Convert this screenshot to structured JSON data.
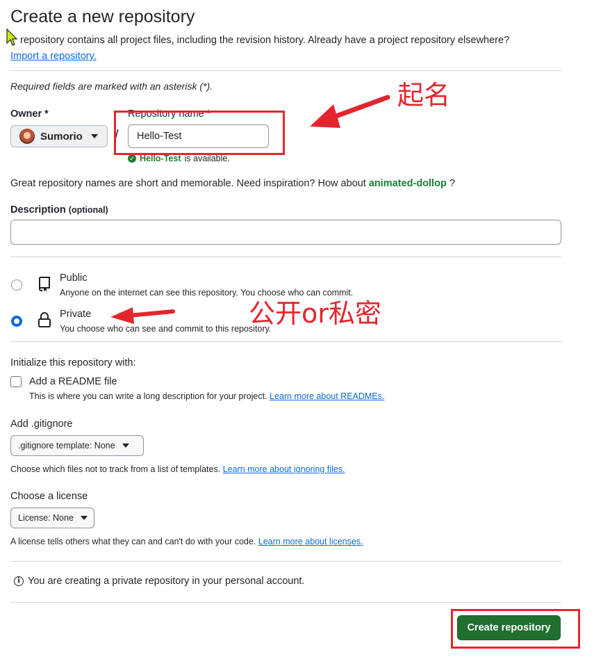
{
  "page": {
    "title": "Create a new repository",
    "intro": "repository contains all project files, including the revision history. Already have a project repository elsewhere?",
    "import_link": "Import a repository.",
    "required_note": "Required fields are marked with an asterisk (*)."
  },
  "owner": {
    "label": "Owner *",
    "value": "Sumorio"
  },
  "repo_name": {
    "label": "Repository name *",
    "value": "Hello-Test",
    "available_name": "Hello-Test",
    "available_text": "is available."
  },
  "suggestion": {
    "prefix": "Great repository names are short and memorable. Need inspiration? How about",
    "name": "animated-dollop",
    "suffix": "?"
  },
  "description": {
    "label": "Description",
    "optional": "(optional)",
    "value": ""
  },
  "visibility": {
    "selected": "private",
    "public": {
      "title": "Public",
      "desc": "Anyone on the internet can see this repository. You choose who can commit."
    },
    "private": {
      "title": "Private",
      "desc": "You choose who can see and commit to this repository."
    }
  },
  "init": {
    "heading": "Initialize this repository with:",
    "readme_label": "Add a README file",
    "readme_checked": false,
    "readme_desc": "This is where you can write a long description for your project.",
    "readme_link": "Learn more about READMEs."
  },
  "gitignore": {
    "heading": "Add .gitignore",
    "button": ".gitignore template: None",
    "desc": "Choose which files not to track from a list of templates.",
    "link": "Learn more about ignoring files."
  },
  "license": {
    "heading": "Choose a license",
    "button": "License: None",
    "desc": "A license tells others what they can and can't do with your code.",
    "link": "Learn more about licenses."
  },
  "notice": "You are creating a private repository in your personal account.",
  "create_button": "Create repository",
  "annotations": {
    "name_note": "起名",
    "visibility_note": "公开or私密",
    "color": "#e3262d"
  },
  "colors": {
    "primary_button": "#1f6f2f",
    "link": "#0969da",
    "success": "#1a7f37"
  }
}
